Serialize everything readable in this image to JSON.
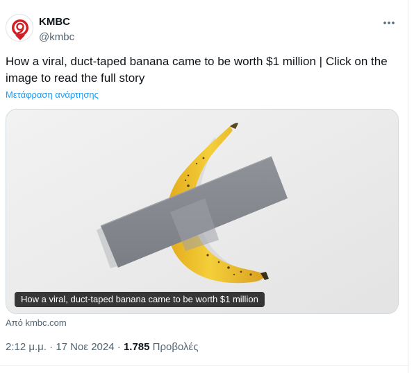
{
  "author": {
    "name": "KMBC",
    "handle": "@kmbc",
    "avatar_icon": "kmbc-9-logo",
    "brand_color": "#d21f26"
  },
  "tweet": {
    "text": "How a viral, duct-taped banana came to be worth $1 million | Click on the image to read the full story",
    "translate_label": "Μετάφραση ανάρτησης"
  },
  "media": {
    "image_subject": "banana duct-taped to a white wall",
    "caption": "How a viral, duct-taped banana came to be worth $1 million",
    "source": "Από kmbc.com"
  },
  "meta": {
    "time": "2:12 μ.μ.",
    "separator": "·",
    "date": "17 Νοε 2024",
    "views_count": "1.785",
    "views_label": "Προβολές"
  },
  "icons": {
    "more": "more-horizontal-icon"
  },
  "colors": {
    "link": "#1d9bf0",
    "secondary_text": "#536471",
    "primary_text": "#0f1419"
  }
}
